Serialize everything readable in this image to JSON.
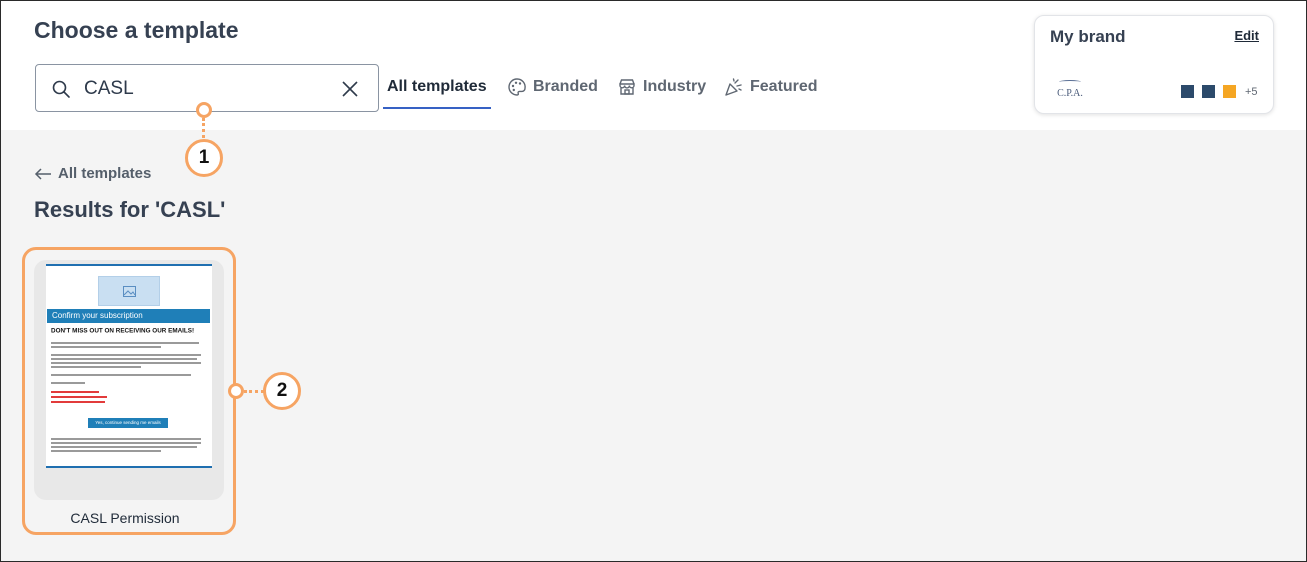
{
  "header": {
    "title": "Choose a template",
    "search": {
      "value": "CASL",
      "placeholder": ""
    },
    "tabs": [
      {
        "label": "All templates",
        "icon": "none",
        "active": true
      },
      {
        "label": "Branded",
        "icon": "palette-icon",
        "active": false
      },
      {
        "label": "Industry",
        "icon": "storefront-icon",
        "active": false
      },
      {
        "label": "Featured",
        "icon": "party-popper-icon",
        "active": false
      }
    ]
  },
  "brand": {
    "title": "My brand",
    "edit_label": "Edit",
    "logo_text": "C.P.A.",
    "swatches": [
      "#2c4a6b",
      "#2c4a6b",
      "#f5a623"
    ],
    "more_count": "+5"
  },
  "main": {
    "back_label": "All templates",
    "results_title": "Results for 'CASL'",
    "templates": [
      {
        "name": "CASL Permission",
        "preview_banner": "Confirm your subscription",
        "preview_heading": "DON'T MISS OUT ON RECEIVING OUR EMAILS!",
        "preview_button": "Yes, continue sending me emails"
      }
    ]
  },
  "callouts": [
    "1",
    "2"
  ],
  "colors": {
    "accent": "#3661c4",
    "callout": "#f6a463",
    "banner": "#1f7fb8"
  }
}
